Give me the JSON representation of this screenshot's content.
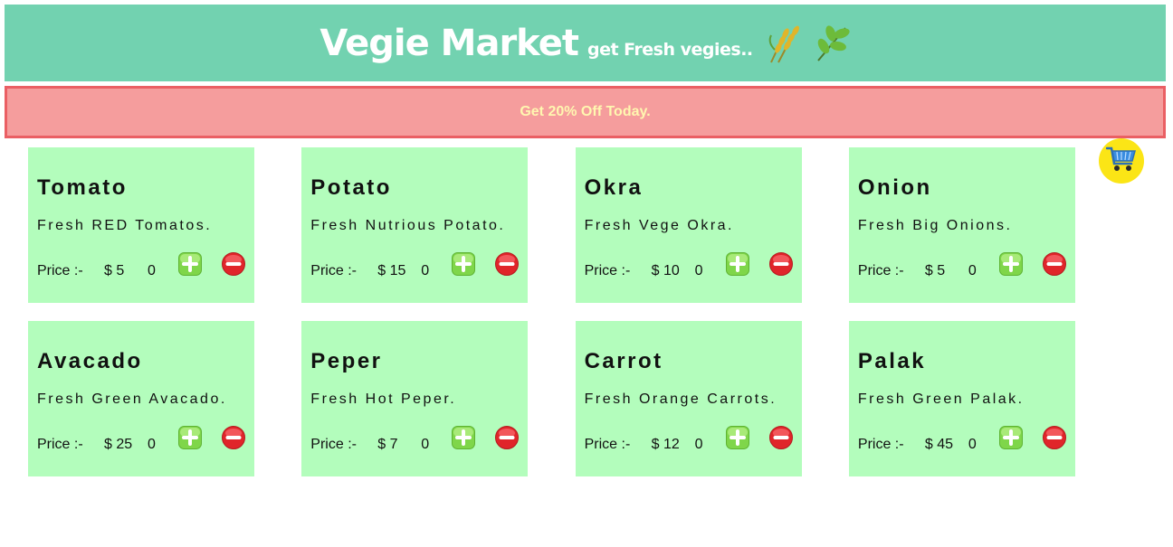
{
  "header": {
    "title": "Vegie Market",
    "tagline": "get Fresh vegies..",
    "icons": [
      "wheat-icon",
      "herb-icon"
    ],
    "background": "#72d2b0"
  },
  "offer": {
    "text": "Get 20% Off Today.",
    "background": "#f59d9d",
    "border": "#ea5f64",
    "text_color": "#fff7b0"
  },
  "cart": {
    "icon": "cart-icon",
    "background": "#fbe516"
  },
  "labels": {
    "price": "Price :-"
  },
  "products": [
    {
      "name": "Tomato",
      "description": "Fresh RED Tomatos.",
      "price": "$ 5",
      "qty": "0"
    },
    {
      "name": "Potato",
      "description": "Fresh Nutrious Potato.",
      "price": "$ 15",
      "qty": "0"
    },
    {
      "name": "Okra",
      "description": "Fresh Vege Okra.",
      "price": "$ 10",
      "qty": "0"
    },
    {
      "name": "Onion",
      "description": "Fresh Big Onions.",
      "price": "$ 5",
      "qty": "0"
    },
    {
      "name": "Avacado",
      "description": "Fresh Green Avacado.",
      "price": "$ 25",
      "qty": "0"
    },
    {
      "name": "Peper",
      "description": "Fresh Hot Peper.",
      "price": "$ 7",
      "qty": "0"
    },
    {
      "name": "Carrot",
      "description": "Fresh Orange Carrots.",
      "price": "$ 12",
      "qty": "0"
    },
    {
      "name": "Palak",
      "description": "Fresh Green Palak.",
      "price": "$ 45",
      "qty": "0"
    }
  ],
  "card_background": "#b3fdbc"
}
